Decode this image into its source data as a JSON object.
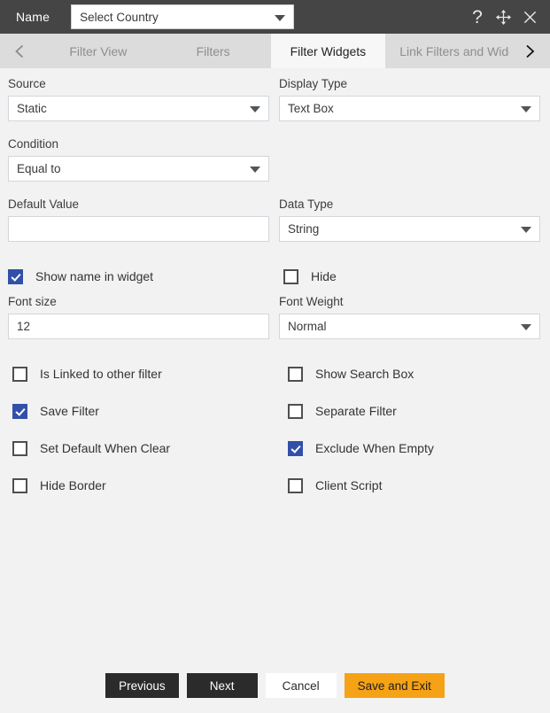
{
  "titlebar": {
    "name_label": "Name",
    "name_value": "Select Country",
    "help_icon": "question-mark-icon",
    "move_icon": "move-arrows-icon",
    "close_icon": "close-x-icon"
  },
  "tabbar": {
    "prev_icon": "chevron-left-icon",
    "next_icon": "chevron-right-icon",
    "tabs": [
      {
        "label": "Filter View",
        "active": false
      },
      {
        "label": "Filters",
        "active": false
      },
      {
        "label": "Filter Widgets",
        "active": true
      },
      {
        "label": "Link Filters and Widge",
        "active": false
      }
    ]
  },
  "form": {
    "source": {
      "label": "Source",
      "value": "Static"
    },
    "display_type": {
      "label": "Display Type",
      "value": "Text Box"
    },
    "condition": {
      "label": "Condition",
      "value": "Equal to"
    },
    "default_value": {
      "label": "Default Value",
      "value": "",
      "placeholder": ""
    },
    "data_type": {
      "label": "Data Type",
      "value": "String"
    },
    "font_size": {
      "label": "Font size",
      "value": "12"
    },
    "font_weight": {
      "label": "Font Weight",
      "value": "Normal"
    }
  },
  "checkboxes": [
    {
      "label": "Show name in widget",
      "checked": true
    },
    {
      "label": "Hide",
      "checked": false
    },
    {
      "label": "Is Linked to other filter",
      "checked": false
    },
    {
      "label": "Show Search Box",
      "checked": false
    },
    {
      "label": "Save Filter",
      "checked": true
    },
    {
      "label": "Separate Filter",
      "checked": false
    },
    {
      "label": "Set Default When Clear",
      "checked": false
    },
    {
      "label": "Exclude When Empty",
      "checked": true
    },
    {
      "label": "Hide Border",
      "checked": false
    },
    {
      "label": "Client Script",
      "checked": false
    }
  ],
  "footer": {
    "previous": "Previous",
    "next": "Next",
    "cancel": "Cancel",
    "save_and_exit": "Save and Exit"
  },
  "colors": {
    "titlebar_bg": "#454545",
    "tabbar_bg": "#dcdcdc",
    "active_tab_bg": "#f7f7f7",
    "body_bg": "#f2f2f2",
    "checkbox_checked": "#3250a8",
    "accent_button": "#f5a216",
    "dark_button": "#2b2b2b"
  }
}
